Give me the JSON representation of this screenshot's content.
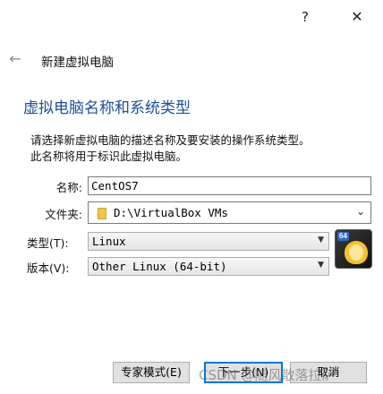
{
  "titlebar": {
    "help": "?",
    "close": "✕"
  },
  "wizard": {
    "back": "←",
    "title": "新建虚拟电脑"
  },
  "section": {
    "title": "虚拟电脑名称和系统类型",
    "description_line1": "请选择新虚拟电脑的描述名称及要安装的操作系统类型。",
    "description_line2": "此名称将用于标识此虚拟电脑。"
  },
  "form": {
    "name_label": "名称:",
    "name_value": "CentOS7",
    "folder_label": "文件夹:",
    "folder_value": "D:\\VirtualBox VMs",
    "type_label": "类型(T):",
    "type_value": "Linux",
    "version_label": "版本(V):",
    "version_value": "Other Linux (64-bit)"
  },
  "os_icon": {
    "badge": "64"
  },
  "footer": {
    "expert_label": "专家模式(E)",
    "next_label": "下一步(N)",
    "cancel_label": "取消"
  },
  "watermark": "CSDN @随风散落拉萨"
}
